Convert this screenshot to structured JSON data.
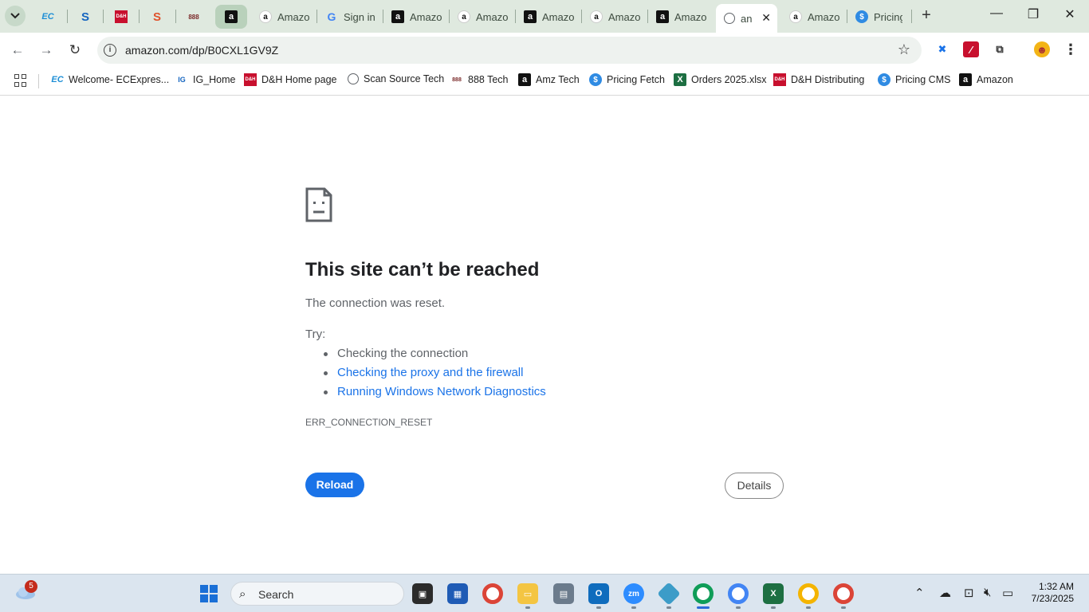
{
  "browser": {
    "tabs": [
      {
        "label": "Amazo",
        "favicon": "amazon-light"
      },
      {
        "label": "Sign in",
        "favicon": "google"
      },
      {
        "label": "Amazo",
        "favicon": "amazon-dark"
      },
      {
        "label": "Amazo",
        "favicon": "amazon-light"
      },
      {
        "label": "Amazo",
        "favicon": "amazon-dark"
      },
      {
        "label": "Amazo",
        "favicon": "amazon-light"
      },
      {
        "label": "Amazo",
        "favicon": "amazon-dark"
      },
      {
        "label": "an",
        "favicon": "globe",
        "active": true
      },
      {
        "label": "Amazo",
        "favicon": "amazon-light"
      },
      {
        "label": "Pricing",
        "favicon": "dollar"
      }
    ],
    "pinned_tabs": [
      {
        "glyph": "EC"
      },
      {
        "glyph": "S"
      },
      {
        "glyph": "D&H"
      },
      {
        "glyph": "S"
      },
      {
        "glyph": "888"
      },
      {
        "glyph": "a"
      }
    ],
    "address": "amazon.com/dp/B0CXL1GV9Z",
    "bookmarks": [
      {
        "label": "Welcome- ECExpres...",
        "favicon": "EC"
      },
      {
        "label": "IG_Home",
        "favicon": "IG"
      },
      {
        "label": "D&H Home page",
        "favicon": "D&H"
      },
      {
        "label": "Scan Source Tech",
        "favicon": "globe"
      },
      {
        "label": "888 Tech",
        "favicon": "888"
      },
      {
        "label": "Amz Tech",
        "favicon": "a"
      },
      {
        "label": "Pricing Fetch",
        "favicon": "$"
      },
      {
        "label": "Orders 2025.xlsx",
        "favicon": "X"
      },
      {
        "label": "D&H Distributing",
        "favicon": "D&H"
      },
      {
        "label": "Pricing CMS",
        "favicon": "$"
      },
      {
        "label": "Amazon",
        "favicon": "a"
      }
    ]
  },
  "error_page": {
    "title": "This site can’t be reached",
    "description": "The connection was reset.",
    "try_label": "Try:",
    "suggestions": [
      "Checking the connection",
      "Checking the proxy and the firewall",
      "Running Windows Network Diagnostics"
    ],
    "error_code": "ERR_CONNECTION_RESET",
    "reload_label": "Reload",
    "details_label": "Details"
  },
  "taskbar": {
    "weather_badge": "5",
    "search_placeholder": "Search",
    "time": "1:32 AM",
    "date": "7/23/2025"
  },
  "colors": {
    "tabstrip_bg": "#dfe9df",
    "link_blue": "#1a73e8",
    "taskbar_bg": "#dbe5ef"
  }
}
